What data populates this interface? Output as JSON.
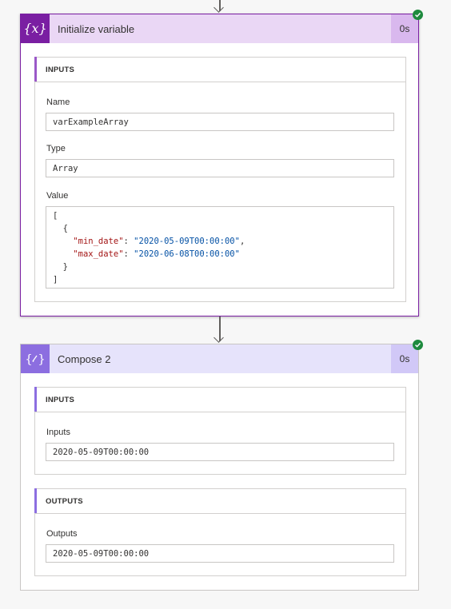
{
  "steps": [
    {
      "title": "Initialize variable",
      "duration": "0s",
      "icon": "curly-x-icon",
      "status": "succeeded",
      "inputs_header": "INPUTS",
      "name_label": "Name",
      "name_value": "varExampleArray",
      "type_label": "Type",
      "type_value": "Array",
      "value_label": "Value",
      "value_lines": {
        "open_bracket": "[",
        "open_brace": "{",
        "min_key": "\"min_date\"",
        "min_val": "\"2020-05-09T00:00:00\"",
        "max_key": "\"max_date\"",
        "max_val": "\"2020-06-08T00:00:00\"",
        "close_brace": "}",
        "close_bracket": "]"
      }
    },
    {
      "title": "Compose 2",
      "duration": "0s",
      "icon": "curly-compose-icon",
      "status": "succeeded",
      "inputs_header": "INPUTS",
      "inputs_label": "Inputs",
      "inputs_value": "2020-05-09T00:00:00",
      "outputs_header": "OUTPUTS",
      "outputs_label": "Outputs",
      "outputs_value": "2020-05-09T00:00:00"
    }
  ],
  "colors": {
    "init_accent": "#7a1fa2",
    "compose_accent": "#8c6ee0",
    "success": "#1e8a3e"
  }
}
